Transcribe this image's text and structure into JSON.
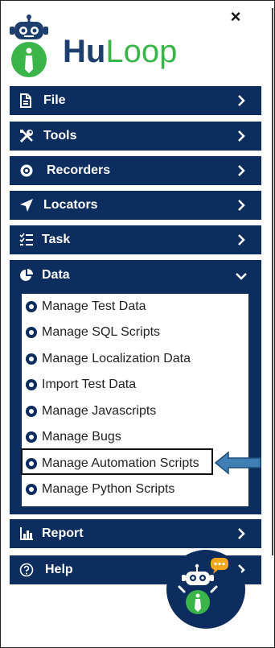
{
  "brand": {
    "hu": "Hu",
    "loop": "Loop"
  },
  "close_label": "×",
  "menu": {
    "file": "File",
    "tools": "Tools",
    "recorders": "Recorders",
    "locators": "Locators",
    "task": "Task",
    "data": "Data",
    "report": "Report",
    "help": "Help"
  },
  "data_items": [
    "Manage Test Data",
    "Manage SQL Scripts",
    "Manage Localization Data",
    "Import Test Data",
    "Manage Javascripts",
    "Manage Bugs",
    "Manage Automation Scripts",
    "Manage Python Scripts"
  ],
  "colors": {
    "navy": "#0d2d5e",
    "brand_green": "#3ab54a",
    "arrow_blue": "#3f7fb3",
    "chat_bubble": "#f2a81d"
  },
  "icons": {
    "file": "file-icon",
    "tools": "tools-icon",
    "recorders": "record-icon",
    "locators": "locator-arrow-icon",
    "task": "task-list-icon",
    "data": "pie-chart-icon",
    "report": "report-icon",
    "help": "help-circle-icon"
  }
}
